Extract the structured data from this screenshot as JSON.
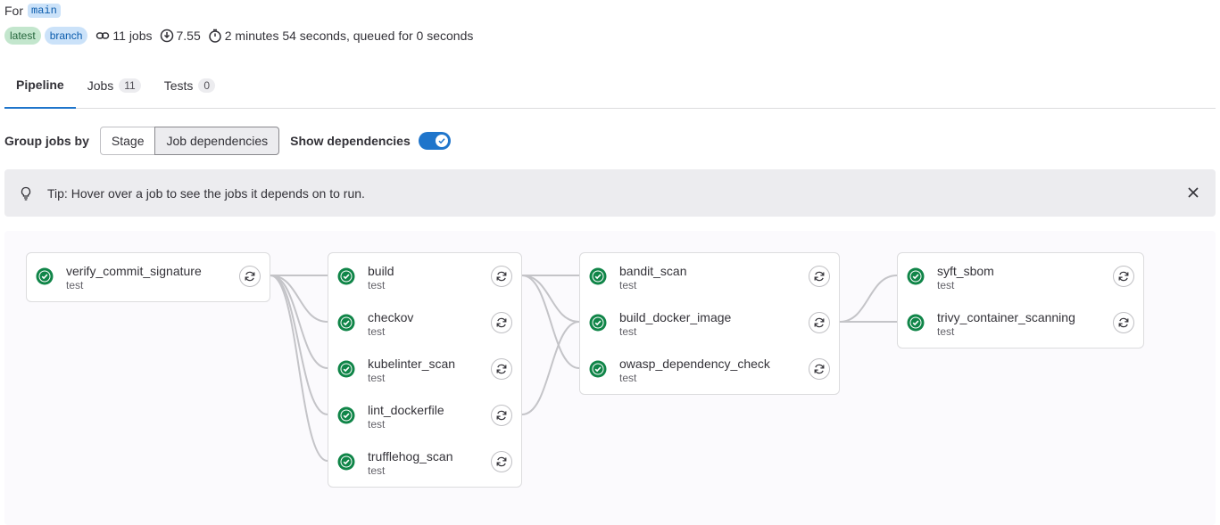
{
  "header": {
    "for_label": "For",
    "ref": "main",
    "badges": [
      "latest",
      "branch"
    ],
    "jobs_count": "11 jobs",
    "score": "7.55",
    "duration": "2 minutes 54 seconds, queued for 0 seconds"
  },
  "tabs": [
    {
      "label": "Pipeline",
      "count": null
    },
    {
      "label": "Jobs",
      "count": "11"
    },
    {
      "label": "Tests",
      "count": "0"
    }
  ],
  "group_by": {
    "label": "Group jobs by",
    "options": [
      "Stage",
      "Job dependencies"
    ],
    "selected": "Job dependencies",
    "show_dependencies_label": "Show dependencies",
    "show_dependencies": true
  },
  "alert": {
    "text": "Tip: Hover over a job to see the jobs it depends on to run."
  },
  "stages": [
    {
      "jobs": [
        {
          "name": "verify_commit_signature",
          "stage": "test"
        }
      ]
    },
    {
      "jobs": [
        {
          "name": "build",
          "stage": "test"
        },
        {
          "name": "checkov",
          "stage": "test"
        },
        {
          "name": "kubelinter_scan",
          "stage": "test"
        },
        {
          "name": "lint_dockerfile",
          "stage": "test"
        },
        {
          "name": "trufflehog_scan",
          "stage": "test"
        }
      ]
    },
    {
      "jobs": [
        {
          "name": "bandit_scan",
          "stage": "test"
        },
        {
          "name": "build_docker_image",
          "stage": "test"
        },
        {
          "name": "owasp_dependency_check",
          "stage": "test"
        }
      ]
    },
    {
      "jobs": [
        {
          "name": "syft_sbom",
          "stage": "test"
        },
        {
          "name": "trivy_container_scanning",
          "stage": "test"
        }
      ]
    }
  ],
  "colors": {
    "success": "#108548",
    "accent": "#1f75cb",
    "link": "#c4c4c8"
  },
  "icons": {
    "status": "status-success-icon",
    "retry": "retry-icon",
    "tip": "bulb-icon",
    "close": "close-icon",
    "jobs": "pipeline-link-icon",
    "score": "download-icon",
    "duration": "timer-icon"
  }
}
